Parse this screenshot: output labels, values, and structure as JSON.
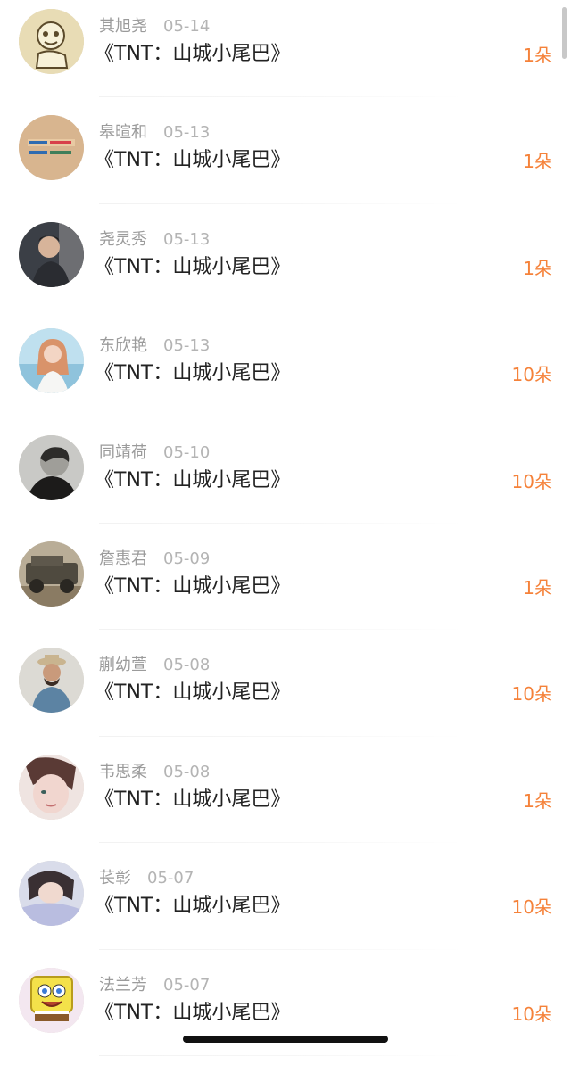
{
  "entries": [
    {
      "name": "其旭尧",
      "date": "05-14",
      "title": "《TNT：山城小尾巴》",
      "count": "1朵",
      "avatar": "cartoon-sketch-avatar"
    },
    {
      "name": "皋暄和",
      "date": "05-13",
      "title": "《TNT：山城小尾巴》",
      "count": "1朵",
      "avatar": "text-slogan-avatar"
    },
    {
      "name": "尧灵秀",
      "date": "05-13",
      "title": "《TNT：山城小尾巴》",
      "count": "1朵",
      "avatar": "man-photo-avatar"
    },
    {
      "name": "东欣艳",
      "date": "05-13",
      "title": "《TNT：山城小尾巴》",
      "count": "10朵",
      "avatar": "girl-beach-avatar"
    },
    {
      "name": "同靖荷",
      "date": "05-10",
      "title": "《TNT：山城小尾巴》",
      "count": "10朵",
      "avatar": "blurred-portrait-avatar"
    },
    {
      "name": "詹惠君",
      "date": "05-09",
      "title": "《TNT：山城小尾巴》",
      "count": "1朵",
      "avatar": "jeep-photo-avatar"
    },
    {
      "name": "蒯幼萱",
      "date": "05-08",
      "title": "《TNT：山城小尾巴》",
      "count": "10朵",
      "avatar": "man-hat-avatar"
    },
    {
      "name": "韦思柔",
      "date": "05-08",
      "title": "《TNT：山城小尾巴》",
      "count": "1朵",
      "avatar": "woman-closeup-avatar"
    },
    {
      "name": "苌彰",
      "date": "05-07",
      "title": "《TNT：山城小尾巴》",
      "count": "10朵",
      "avatar": "girl-lying-avatar"
    },
    {
      "name": "法兰芳",
      "date": "05-07",
      "title": "《TNT：山城小尾巴》",
      "count": "10朵",
      "avatar": "spongebob-avatar"
    }
  ]
}
